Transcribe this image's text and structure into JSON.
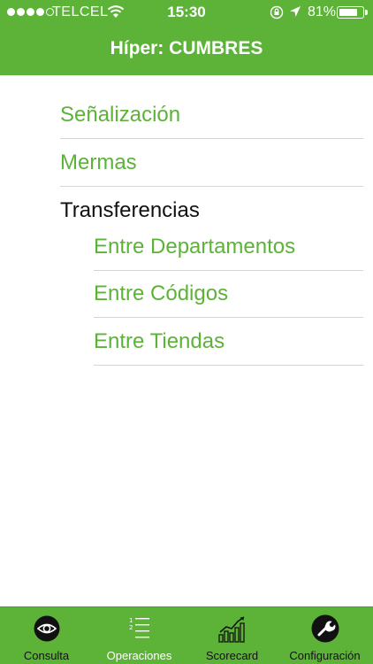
{
  "status_bar": {
    "carrier": "TELCEL",
    "time": "15:30",
    "battery_percent": "81%",
    "battery_level": 0.81
  },
  "nav": {
    "title": "Híper: CUMBRES"
  },
  "menu": {
    "items": [
      {
        "label": "Señalización"
      },
      {
        "label": "Mermas"
      },
      {
        "label": "Transferencias"
      },
      {
        "label": "Entre Departamentos"
      },
      {
        "label": "Entre Códigos"
      },
      {
        "label": "Entre Tiendas"
      }
    ]
  },
  "tabbar": {
    "tabs": [
      {
        "label": "Consulta",
        "icon": "eye-icon"
      },
      {
        "label": "Operaciones",
        "icon": "list-icon"
      },
      {
        "label": "Scorecard",
        "icon": "bar-chart-icon"
      },
      {
        "label": "Configuración",
        "icon": "wrench-icon"
      }
    ],
    "active_index": 1
  },
  "colors": {
    "accent": "#5cb338",
    "text_dark": "#111111",
    "divider": "#d6d6d6"
  }
}
